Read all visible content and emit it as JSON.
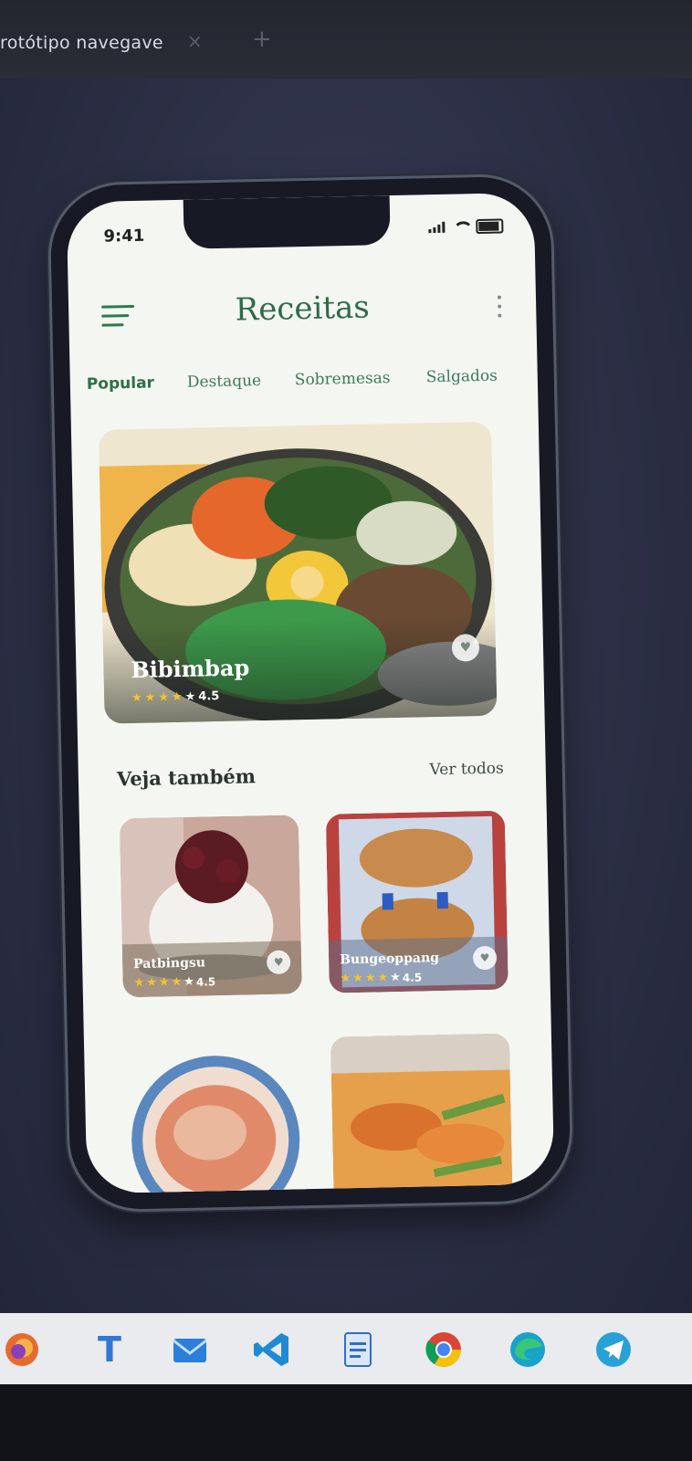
{
  "browser": {
    "tab_title": "rotótipo navegave",
    "tab_close": "×",
    "new_tab": "+"
  },
  "status_bar": {
    "time": "9:41"
  },
  "header": {
    "title": "Receitas"
  },
  "tabs": [
    {
      "label": "Popular",
      "active": true
    },
    {
      "label": "Destaque",
      "active": false
    },
    {
      "label": "Sobremesas",
      "active": false
    },
    {
      "label": "Salgados",
      "active": false
    }
  ],
  "featured": {
    "name": "Bibimbap",
    "rating": "4.5",
    "stars": 5
  },
  "see_also": {
    "title": "Veja também",
    "see_all_label": "Ver todos"
  },
  "cards": [
    {
      "name": "Patbingsu",
      "rating": "4.5"
    },
    {
      "name": "Bungeoppang",
      "rating": "4.5"
    },
    {
      "name": "",
      "rating": ""
    },
    {
      "name": "",
      "rating": ""
    }
  ],
  "taskbar": {
    "apps": [
      "firefox-icon",
      "typora-icon",
      "mail-icon",
      "vscode-icon",
      "document-icon",
      "chrome-icon",
      "edge-icon",
      "telegram-icon"
    ],
    "typora_letter": "T"
  },
  "colors": {
    "accent_green": "#2f6b48",
    "star_yellow": "#f1c430"
  }
}
